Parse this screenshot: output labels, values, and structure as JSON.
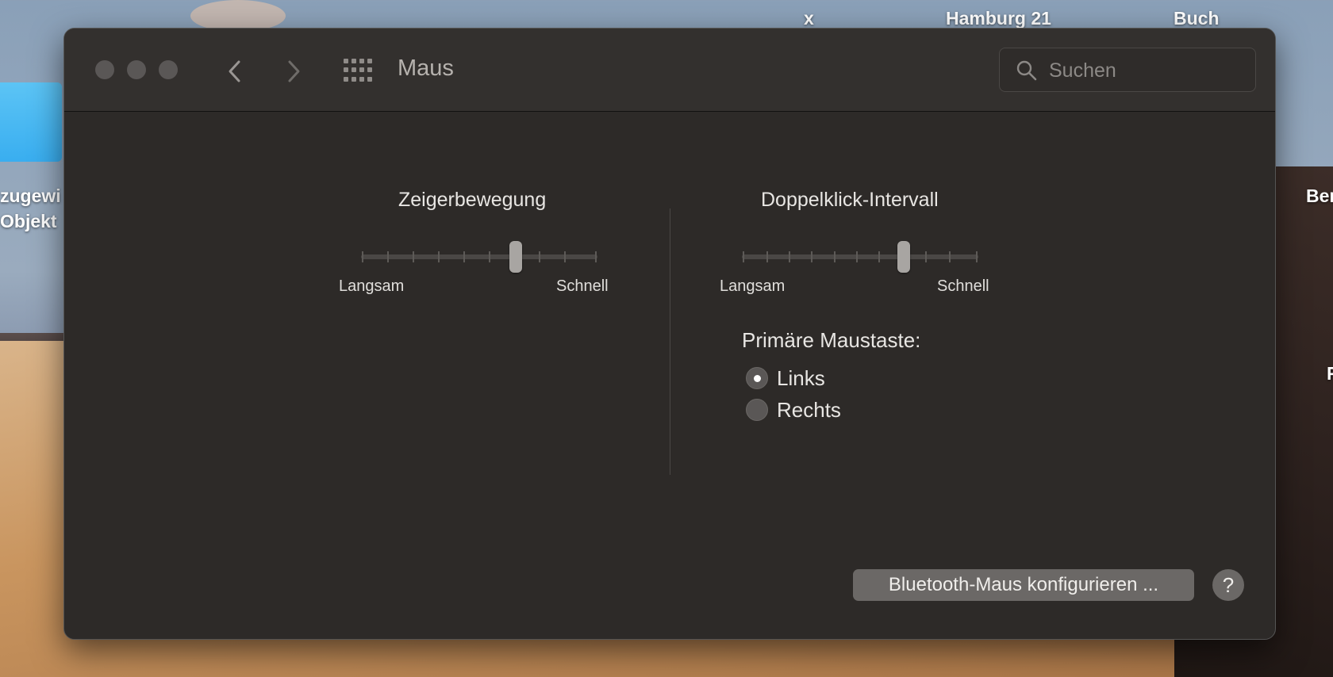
{
  "desktop": {
    "labels": [
      "x",
      "Hamburg 21",
      "Buch",
      "zugewi",
      "Objekt",
      "Ber",
      "F"
    ]
  },
  "window": {
    "title": "Maus",
    "search_placeholder": "Suchen"
  },
  "pointer_speed": {
    "title": "Zeigerbewegung",
    "min_label": "Langsam",
    "max_label": "Schnell",
    "ticks": 10,
    "value_index": 6
  },
  "double_click": {
    "title": "Doppelklick-Intervall",
    "min_label": "Langsam",
    "max_label": "Schnell",
    "ticks": 11,
    "value_index": 7
  },
  "primary_button": {
    "label": "Primäre Maustaste:",
    "options": [
      {
        "label": "Links",
        "checked": true
      },
      {
        "label": "Rechts",
        "checked": false
      }
    ]
  },
  "footer": {
    "bluetooth_label": "Bluetooth-Maus konfigurieren ...",
    "help_label": "?"
  }
}
